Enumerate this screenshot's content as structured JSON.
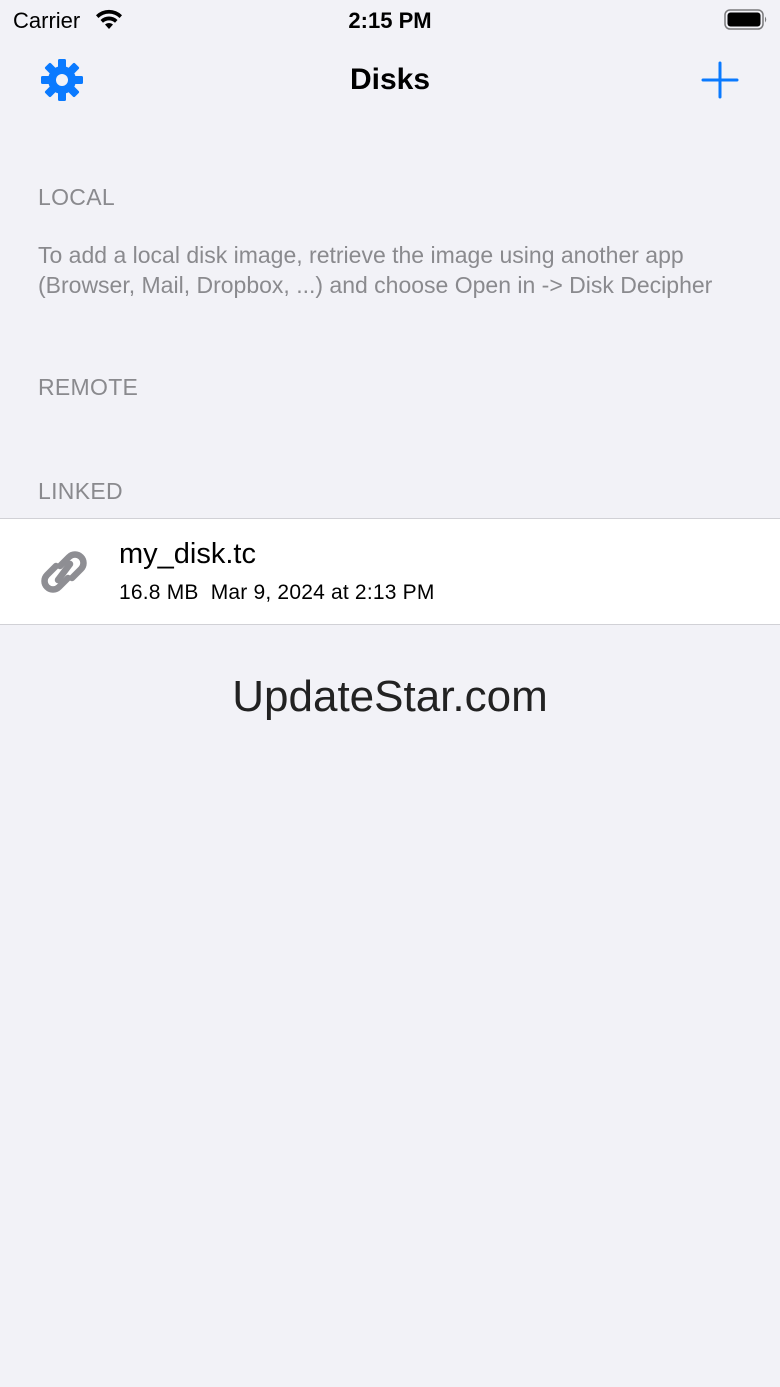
{
  "status_bar": {
    "carrier": "Carrier",
    "time": "2:15 PM"
  },
  "nav": {
    "title": "Disks",
    "settings_icon": "gear-icon",
    "add_icon": "plus-icon",
    "accent_color": "#0a7aff"
  },
  "sections": {
    "local": {
      "header": "LOCAL",
      "footer": "To add a local disk image, retrieve the image using another app (Browser, Mail, Dropbox, ...) and choose Open in -> Disk Decipher"
    },
    "remote": {
      "header": "REMOTE"
    },
    "linked": {
      "header": "LINKED",
      "items": [
        {
          "icon": "link-icon",
          "name": "my_disk.tc",
          "size": "16.8 MB",
          "date": "Mar 9, 2024 at 2:13 PM"
        }
      ]
    }
  },
  "watermark": "UpdateStar.com"
}
